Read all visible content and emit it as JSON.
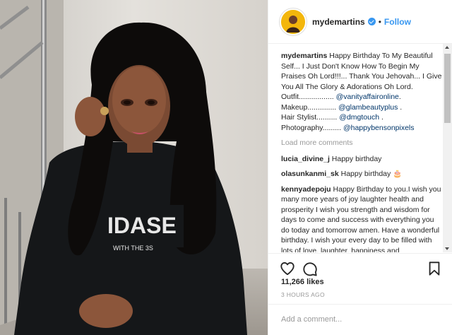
{
  "header": {
    "username": "mydemartins",
    "separator": "•",
    "follow_label": "Follow"
  },
  "caption": {
    "username": "mydemartins",
    "text": "Happy Birthday To My Beautiful Self... I Just Don't Know How To Begin My Praises Oh Lord!!!... Thank You Jehovah... I Give You All The Glory & Adorations Oh Lord.",
    "credits": [
      {
        "label": "Outfit.................",
        "handle": "@vanityaffaironline",
        "suffix": "."
      },
      {
        "label": "Makeup..............",
        "handle": "@glambeautyplus",
        "suffix": " ."
      },
      {
        "label": "Hair Stylist..........",
        "handle": "@dmgtouch",
        "suffix": " ."
      },
      {
        "label": "Photography.........",
        "handle": "@happybensonpixels",
        "suffix": ""
      }
    ]
  },
  "load_more_label": "Load more comments",
  "comments": [
    {
      "username": "lucia_divine_j",
      "text": "Happy birthday"
    },
    {
      "username": "olasunkanmi_sk",
      "text": "Happy birthday 🎂"
    },
    {
      "username": "kennyadepoju",
      "text": "Happy Birthday to you.I wish you many more years of joy laughter health and prosperity I wish you strength and wisdom for days to come and success with everything you do today and tomorrow amen. Have a wonderful birthday. I wish your every day to be filled with lots of love, laughter, happiness and"
    }
  ],
  "likes": "11,266 likes",
  "timestamp": "3 HOURS AGO",
  "add_comment_placeholder": "Add a comment...",
  "icons": [
    "verified-icon",
    "heart-icon",
    "comment-icon",
    "bookmark-icon"
  ],
  "colors": {
    "link": "#3897f0",
    "mention": "#003569",
    "text": "#262626",
    "muted": "#999999"
  }
}
